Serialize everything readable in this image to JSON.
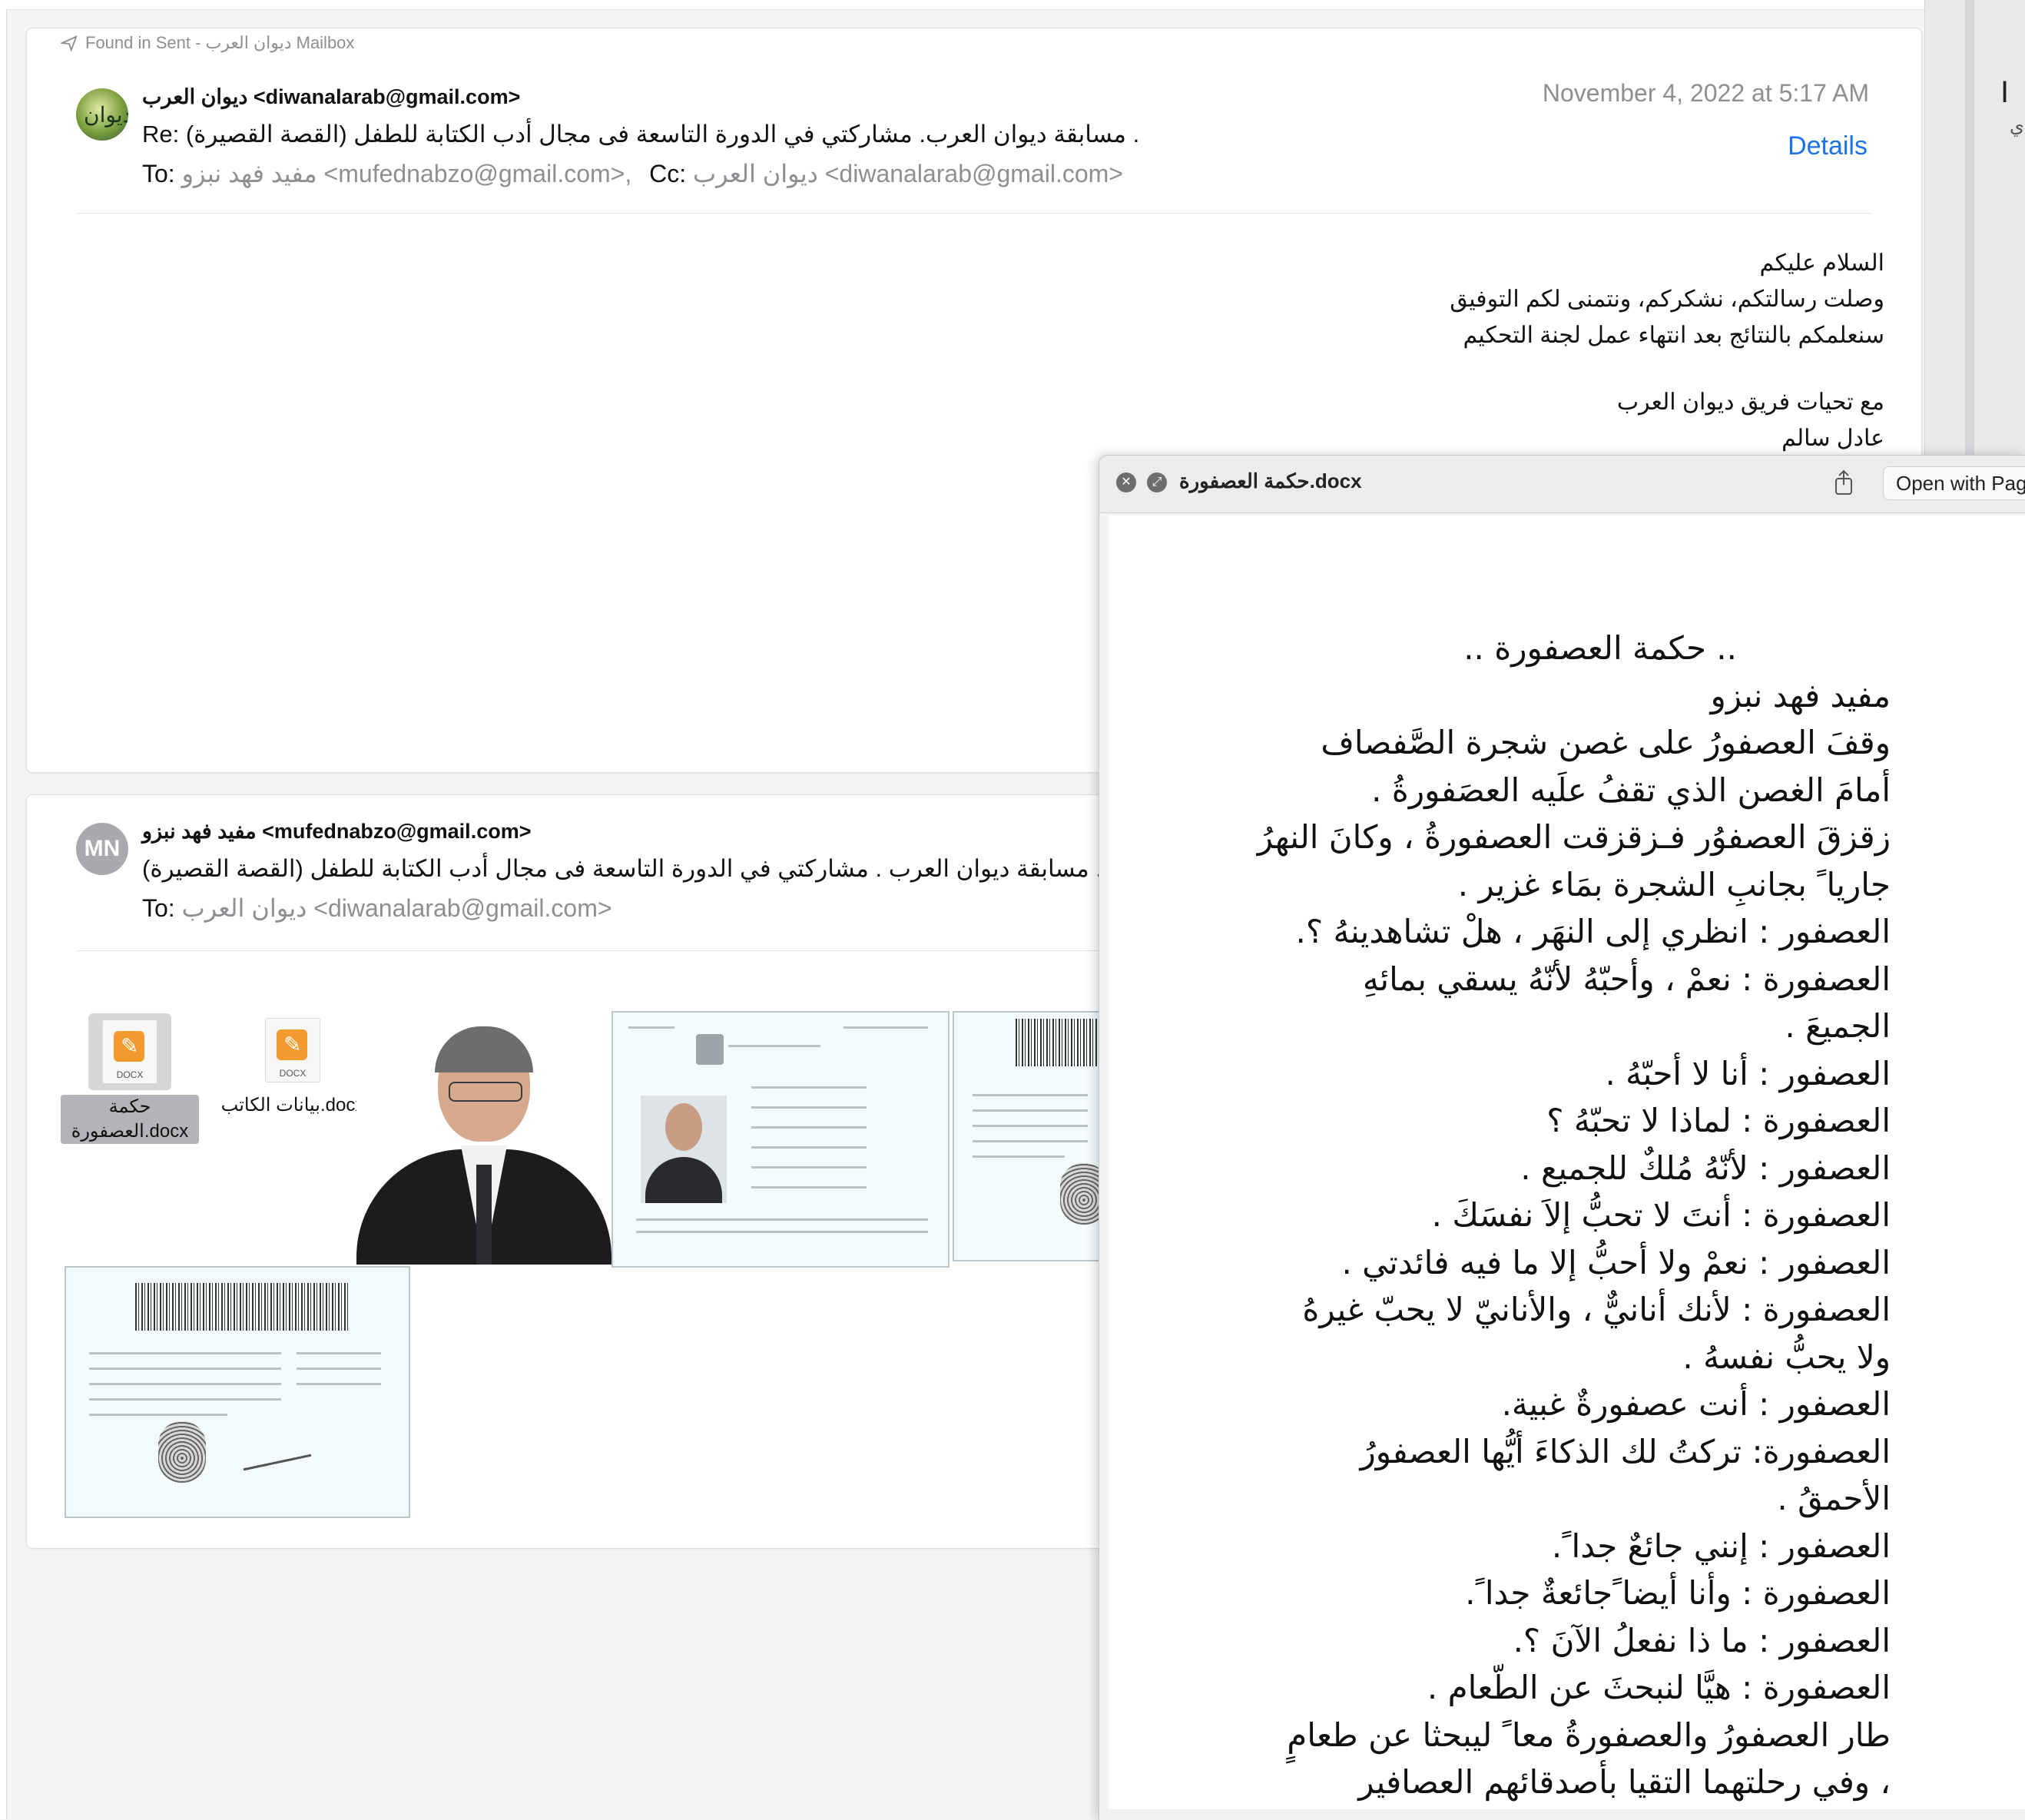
{
  "message1": {
    "found_in": "Found in Sent - ديوان العرب Mailbox",
    "from": "ديوان العرب <diwanalarab@gmail.com>",
    "subject": "Re: مسابقة ديوان العرب. مشاركتي في الدورة التاسعة فى مجال أدب الكتابة للطفل (القصة القصيرة) .",
    "to_label": "To:",
    "to": "مفيد فهد نبزو <mufednabzo@gmail.com>,",
    "cc_label": "Cc:",
    "cc": "ديوان العرب <diwanalarab@gmail.com>",
    "date": "November 4, 2022 at 5:17 AM",
    "details_label": "Details",
    "body_lines": [
      "السلام عليكم",
      "وصلت رسالتكم، نشكركم، ونتمنى لكم التوفيق",
      "سنعلمكم بالنتائج بعد انتهاء عمل لجنة التحكيم",
      "مع تحيات فريق ديوان العرب",
      "عادل سالم"
    ]
  },
  "message2": {
    "avatar_initials": "MN",
    "from": "مفيد فهد نبزو <mufednabzo@gmail.com>",
    "subject": "مسابقة ديوان العرب . مشاركتي في الدورة التاسعة فى مجال أدب الكتابة للطفل (القصة القصيرة) .",
    "to_label": "To:",
    "to": "ديوان العرب <diwanalarab@gmail.com>",
    "attachments": [
      {
        "name_line1": "حكمة",
        "name_line2": "العصفورة.docx",
        "type": "DOCX",
        "selected": true
      },
      {
        "name_line1": "بيانات الكاتب.docx",
        "name_line2": "",
        "type": "DOCX",
        "selected": false
      }
    ]
  },
  "preview": {
    "title": "حكمة العصفورة.docx",
    "open_with": "Open with Pag",
    "story_lines": [
      ".. حكمة العصفورة ..",
      "مفيد فهد نبزو",
      "وقفَ العصفورُ على غصن شجرة الصَّفصاف",
      "أمامَ الغصن الذي تقفُ علَيه العصَفورةُ .",
      "زقزقَ العصفوُر فـزقزقت العصفورةُ ، وكانَ النهرُ",
      "جاريا ً بجانبِ الشجرة بمَاء غزير .",
      "العصفور : انظري إلى النهَر ، هلْ تشاهدينهُ ؟.",
      "العصفورة : نعمْ ، وأحبّهُ لأنّهُ يسقي بمائهِ",
      "الجميعَ .",
      "العصفور : أنا لا أحبّهُ .",
      "العصفورة : لماذا لا تحبّهُ ؟",
      "العصفور : لأنّهُ مُلكٌ للجميع .",
      "العصفورة : أنتَ لا تحبُّ إلاَ نفسَكَ .",
      "العصفور : نعمْ ولا أحبُّ إلا ما فيه فائدتي .",
      "العصفورة : لأنك أنانيٌّ ، والأنانيّ لا يحبّ غيرهُ",
      "ولا يحبُّ نفسهُ .",
      "العصفور : أنت عصفورةٌ غبية.",
      "العصفورة: تركتُ لك الذكاءَ أيُّها العصفورُ",
      "الأحمقُ .",
      "العصفور : إنني جائعٌ جدا ً.",
      "العصفورة : وأنا أيضا ًجائعةٌ جدا ً.",
      "العصفور : ما ذا نفعلُ الآنَ ؟.",
      "العصفورة : هيَّا لنبحثَ عن الطّعام .",
      "طار العصفورُ والعصفورةُ معا ً ليبحثا عن طعامٍ",
      "، وفي رحلتهما التقيا بأصدقائهم العصافير"
    ]
  },
  "colors": {
    "accent": "#1a73e8",
    "secondary_text": "#8e8e93",
    "docx_orange": "#f39a2f"
  }
}
